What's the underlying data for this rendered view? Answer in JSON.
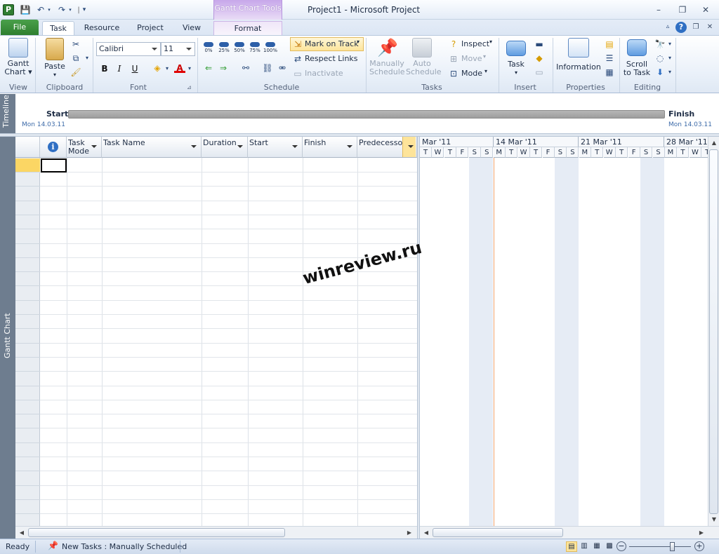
{
  "app": {
    "title": "Project1  -  Microsoft Project",
    "icon_letter": "P",
    "context_tab": "Gantt Chart Tools"
  },
  "quick_access": {
    "save": "save-icon",
    "undo": "undo-icon",
    "redo": "redo-icon",
    "customize": "customize-icon"
  },
  "window_controls": {
    "minimize": "–",
    "restore": "❐",
    "close": "✕"
  },
  "ribbon_tabs": [
    "File",
    "Task",
    "Resource",
    "Project",
    "View",
    "Format"
  ],
  "active_tab": "Task",
  "ribbon": {
    "view": {
      "gantt_label": "Gantt",
      "gantt_label2": "Chart",
      "group": "View"
    },
    "clipboard": {
      "paste": "Paste",
      "group": "Clipboard"
    },
    "font": {
      "family": "Calibri",
      "size": "11",
      "bold": "B",
      "italic": "I",
      "underline": "U",
      "color_a": "A",
      "group": "Font"
    },
    "schedule": {
      "pcts": [
        "0%",
        "25%",
        "50%",
        "75%",
        "100%"
      ],
      "mark_on_track": "Mark on Track",
      "respect_links": "Respect Links",
      "inactivate": "Inactivate",
      "group": "Schedule"
    },
    "tasks": {
      "manually": "Manually",
      "schedule1": "Schedule",
      "auto": "Auto",
      "schedule2": "Schedule",
      "inspect": "Inspect",
      "move": "Move",
      "mode": "Mode",
      "group": "Tasks"
    },
    "insert": {
      "task": "Task",
      "group": "Insert"
    },
    "properties": {
      "information": "Information",
      "group": "Properties"
    },
    "editing": {
      "scroll": "Scroll",
      "to_task": "to Task",
      "group": "Editing"
    }
  },
  "timeline": {
    "side_label": "Timeline",
    "start_label": "Start",
    "start_date": "Mon 14.03.11",
    "finish_label": "Finish",
    "finish_date": "Mon 14.03.11"
  },
  "view_side_label": "Gantt Chart",
  "grid": {
    "columns": [
      "Task Mode",
      "Task Name",
      "Duration",
      "Start",
      "Finish",
      "Predecessors"
    ],
    "task_mode_line1": "Task",
    "task_mode_line2": "Mode",
    "info_icon": "i"
  },
  "timescale": {
    "weeks": [
      "Mar '11",
      "14 Mar '11",
      "21 Mar '11",
      "28 Mar '11"
    ],
    "days_first": [
      "T",
      "W",
      "T",
      "F",
      "S",
      "S"
    ],
    "days_week": [
      "M",
      "T",
      "W",
      "T",
      "F",
      "S",
      "S"
    ],
    "days_last": [
      "M",
      "T",
      "W",
      "T"
    ]
  },
  "watermark": "winreview.ru",
  "status": {
    "ready": "Ready",
    "new_tasks": "New Tasks : Manually Scheduled"
  }
}
